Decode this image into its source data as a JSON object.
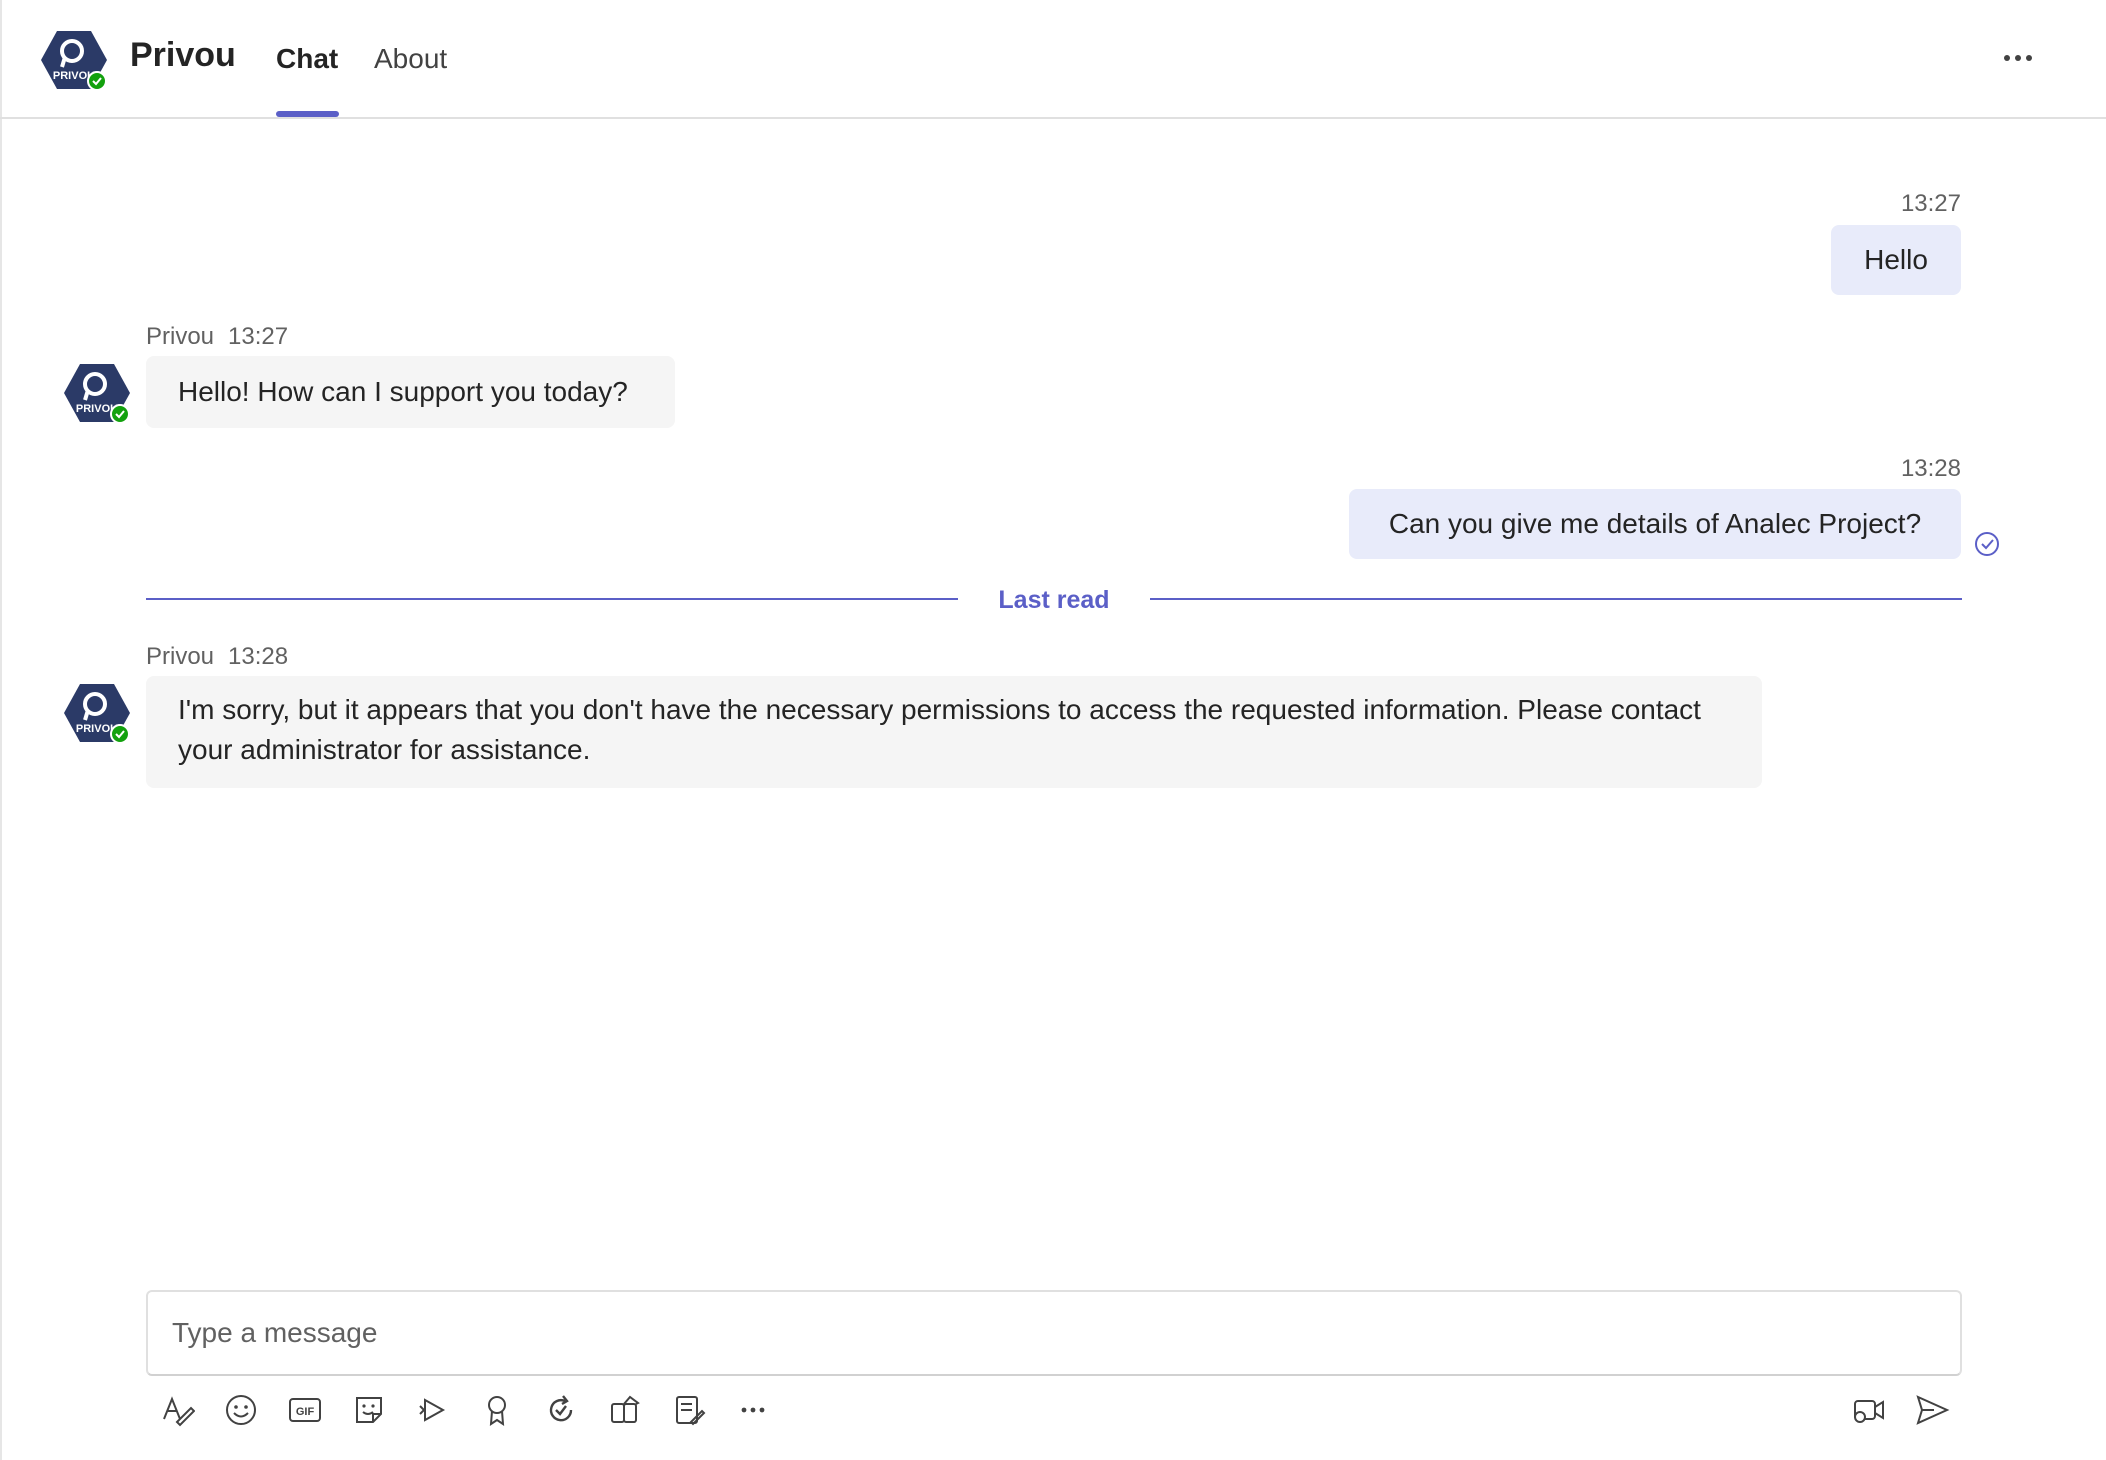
{
  "header": {
    "app_name": "Privou",
    "tabs": [
      {
        "label": "Chat",
        "active": true
      },
      {
        "label": "About",
        "active": false
      }
    ],
    "more_icon": "more-horizontal-icon",
    "avatar_text": "PRIVOU"
  },
  "messages": [
    {
      "from": "me",
      "time": "13:27",
      "text": "Hello"
    },
    {
      "from": "bot",
      "sender": "Privou",
      "time": "13:27",
      "text": "Hello! How can I support you today?"
    },
    {
      "from": "me",
      "time": "13:28",
      "text": "Can you give me details of Analec Project?",
      "status_icon": "seen-check-icon"
    },
    {
      "from": "bot",
      "sender": "Privou",
      "time": "13:28",
      "text": "I'm sorry, but it appears that you don't have the necessary permissions to access the requested information. Please contact your administrator for assistance."
    }
  ],
  "divider": {
    "label": "Last read"
  },
  "compose": {
    "placeholder": "Type a message"
  },
  "toolbar": {
    "icons": [
      "format-icon",
      "emoji-icon",
      "gif-icon",
      "sticker-icon",
      "stream-icon",
      "praise-icon",
      "loop-icon",
      "apps-icon",
      "forms-icon",
      "more-options-icon"
    ],
    "right_icons": [
      "meet-now-icon",
      "send-icon"
    ]
  },
  "colors": {
    "accent": "#5b5fc7",
    "my_bubble": "#e8ebfa",
    "bot_bubble": "#f5f5f5",
    "avatar_bg": "#2b3a67",
    "presence": "#13a10e"
  }
}
